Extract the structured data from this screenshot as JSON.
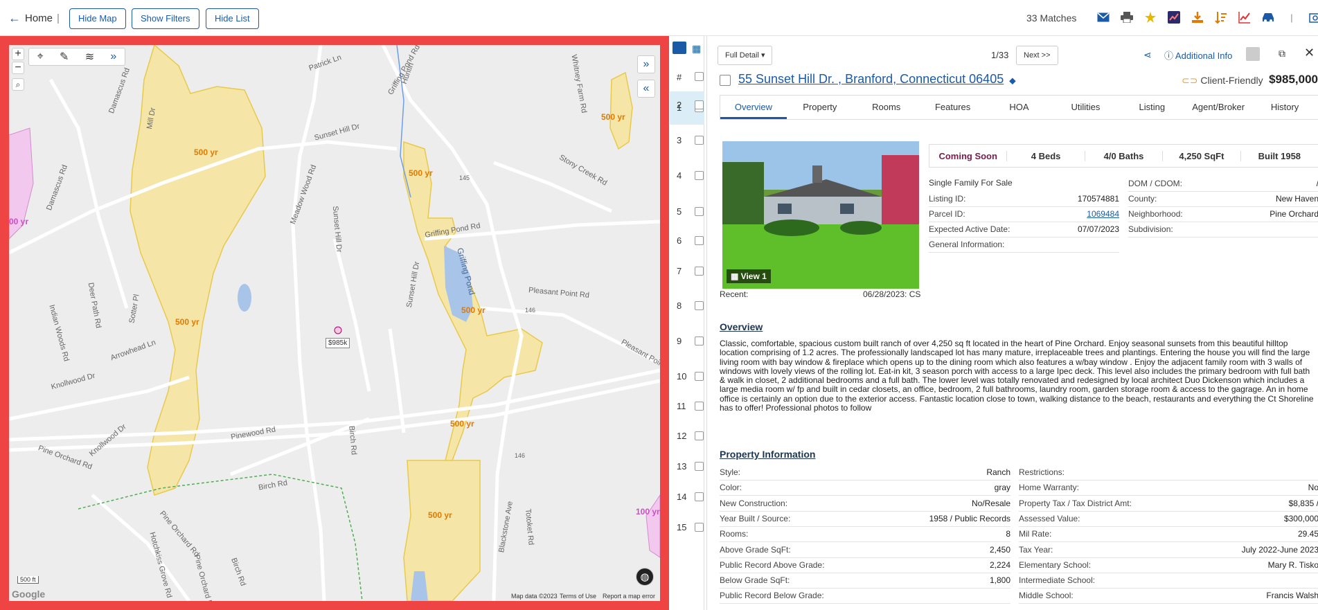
{
  "topbar": {
    "home": "Home",
    "hide_map": "Hide Map",
    "show_filters": "Show Filters",
    "hide_list": "Hide List",
    "matches": "33 Matches"
  },
  "map": {
    "streets": [
      "Patrick Ln",
      "Damascus Rd",
      "Huntin",
      "Sunset Hill Dr",
      "Griffing Pond Rd",
      "Whitney Farm Rd",
      "Stony Creek Rd",
      "Meadow Wood Rd",
      "Sunset Hill Dr",
      "Griffing Pond Rd",
      "Griffing Pond",
      "Pleasant Point Rd",
      "Sunset Hill Dr",
      "Deer Path Rd",
      "Indian Woods Rd",
      "Arrowhead Ln",
      "Sotter Pl",
      "Knollwood Dr",
      "Knollwood Dr",
      "Pinewood Rd",
      "Birch Rd",
      "Pine Orchard Rd",
      "Birch Rd",
      "Pine Orchard Rd",
      "Blackstone Ave",
      "Totoket Rd",
      "Pleasant Point",
      "Hotchkiss Grove Rd",
      "Damascus Rd",
      "Mill Dr",
      "Birch Rd",
      "Pine Orchard Rd"
    ],
    "flood_labels": [
      "500 yr",
      "500 yr",
      "500 yr",
      "500 yr",
      "500 yr",
      "500 yr",
      "500 yr",
      "100 yr",
      "00 yr"
    ],
    "price_tag": "$985k",
    "scale": "500 ft",
    "google": "Google",
    "map_data": "Map data ©2023",
    "terms": "Terms of Use",
    "report": "Report a map error",
    "route_146": "146",
    "route_145": "145"
  },
  "list": {
    "header": "#",
    "rows": [
      "1",
      "2",
      "3",
      "4",
      "5",
      "6",
      "7",
      "8",
      "9",
      "10",
      "11",
      "12",
      "13",
      "14",
      "15"
    ]
  },
  "detail": {
    "full_detail": "Full Detail",
    "pager": "1/33",
    "next": "Next >>",
    "additional_info": "Additional Info",
    "address": "55 Sunset Hill Dr. , Branford, Connecticut 06405",
    "client_friendly": "Client-Friendly",
    "price": "$985,000",
    "tabs": [
      "Overview",
      "Property",
      "Rooms",
      "Features",
      "HOA",
      "Utilities",
      "Listing",
      "Agent/Broker",
      "History"
    ],
    "view_label": "View 1",
    "status": "Coming Soon",
    "beds": "4 Beds",
    "baths": "4/0 Baths",
    "sqft": "4,250 SqFt",
    "built": "Built 1958",
    "type": "Single Family For Sale",
    "left_fields": [
      {
        "k": "Listing ID:",
        "v": "170574881"
      },
      {
        "k": "Parcel ID:",
        "v": "1069484"
      },
      {
        "k": "Expected Active Date:",
        "v": "07/07/2023"
      },
      {
        "k": "General Information:",
        "v": ""
      }
    ],
    "right_fields": [
      {
        "k": "DOM / CDOM:",
        "v": "/"
      },
      {
        "k": "County:",
        "v": "New Haven"
      },
      {
        "k": "Neighborhood:",
        "v": "Pine Orchard"
      },
      {
        "k": "Subdivision:",
        "v": ""
      }
    ],
    "recent_label": "Recent:",
    "recent_value": "06/28/2023: CS",
    "overview_title": "Overview",
    "overview_text": "Classic, comfortable, spacious custom built ranch of over 4,250 sq ft located in the heart of Pine Orchard. Enjoy seasonal sunsets from this beautiful hilltop location comprising of 1.2 acres. The professionally landscaped lot has many mature, irreplaceable trees and plantings. Entering the house you will find the large living room with bay window & fireplace which opens up to the dining room which also features a w/bay window . Enjoy the adjacent family room with 3 walls of windows with lovely views of the rolling lot. Eat-in kit, 3 season porch with access to a large Ipec deck. This level also includes the primary bedroom with full bath & walk in closet, 2 additional bedrooms and a full bath. The lower level was totally renovated and redesigned by local architect Duo Dickenson which includes a large media room w/ fp and built in cedar closets, an office, bedroom, 2 full bathrooms, laundry room, garden storage room & access to the gagrage. An in home office is certainly an option due to the exterior access. Fantastic location close to town, walking distance to the beach, restaurants and everything the Ct Shoreline has to offer! Professional photos to follow",
    "propinfo_title": "Property Information",
    "prop_left": [
      {
        "k": "Style:",
        "v": "Ranch"
      },
      {
        "k": "Color:",
        "v": "gray"
      },
      {
        "k": "New Construction:",
        "v": "No/Resale"
      },
      {
        "k": "Year Built / Source:",
        "v": "1958 / Public Records"
      },
      {
        "k": "Rooms:",
        "v": "8"
      },
      {
        "k": "Above Grade SqFt:",
        "v": "2,450"
      },
      {
        "k": "Public Record Above Grade:",
        "v": "2,224"
      },
      {
        "k": "Below Grade SqFt:",
        "v": "1,800"
      },
      {
        "k": "Public Record Below Grade:",
        "v": ""
      }
    ],
    "prop_right": [
      {
        "k": "Restrictions:",
        "v": ""
      },
      {
        "k": "Home Warranty:",
        "v": "No"
      },
      {
        "k": "Property Tax / Tax District Amt:",
        "v": "$8,835 /"
      },
      {
        "k": "Assessed Value:",
        "v": "$300,000"
      },
      {
        "k": "Mil Rate:",
        "v": "29.45"
      },
      {
        "k": "Tax Year:",
        "v": "July 2022-June 2023"
      },
      {
        "k": "Elementary School:",
        "v": "Mary R. Tisko"
      },
      {
        "k": "Intermediate School:",
        "v": ""
      },
      {
        "k": "Middle School:",
        "v": "Francis Walsh"
      }
    ]
  }
}
